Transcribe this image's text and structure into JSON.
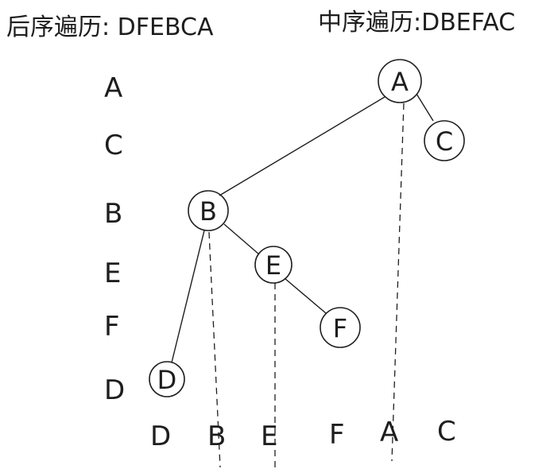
{
  "headers": {
    "postorder": "后序遍历: DFEBCA",
    "inorder": "中序遍历:DBEFAC"
  },
  "postorder_reversed": [
    "A",
    "C",
    "B",
    "E",
    "F",
    "D"
  ],
  "inorder_sequence": [
    "D",
    "B",
    "E",
    "F",
    "A",
    "C"
  ],
  "tree": {
    "nodes": [
      {
        "id": "A",
        "label": "A"
      },
      {
        "id": "C",
        "label": "C"
      },
      {
        "id": "B",
        "label": "B"
      },
      {
        "id": "E",
        "label": "E"
      },
      {
        "id": "F",
        "label": "F"
      },
      {
        "id": "D",
        "label": "D"
      }
    ],
    "edges": [
      {
        "from": "A",
        "to": "B"
      },
      {
        "from": "A",
        "to": "C"
      },
      {
        "from": "B",
        "to": "D"
      },
      {
        "from": "B",
        "to": "E"
      },
      {
        "from": "E",
        "to": "F"
      }
    ]
  }
}
